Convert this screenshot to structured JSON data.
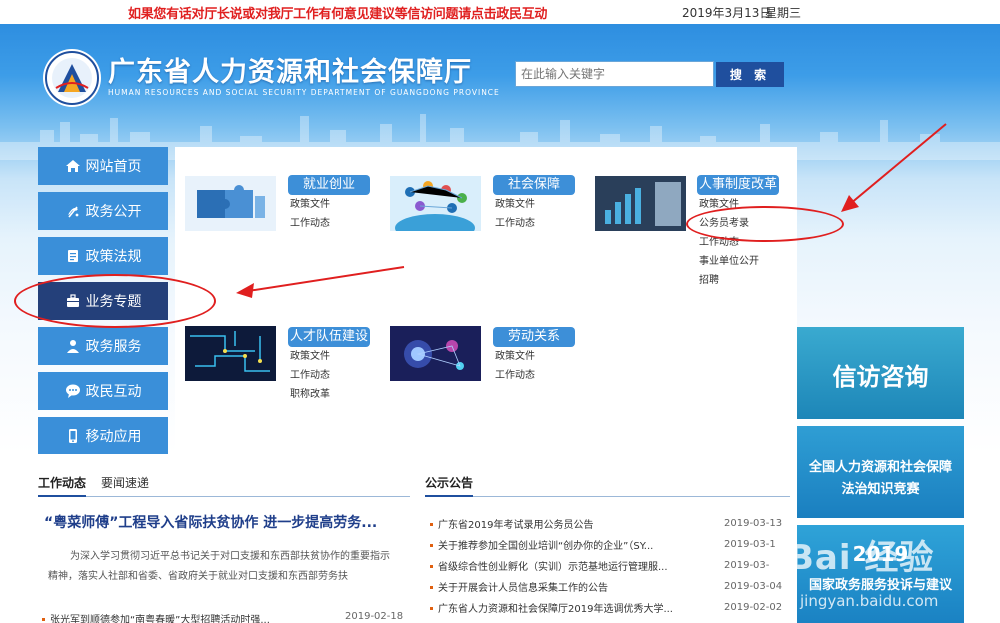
{
  "topbar": {
    "notice": "如果您有话对厅长说或对我厅工作有何意见建议等信访问题请点击政民互动",
    "date": "2019年3月13日",
    "weekday": "星期三"
  },
  "header": {
    "title": "广东省人力资源和社会保障厅",
    "subtitle": "HUMAN RESOURCES AND SOCIAL SECURITY DEPARTMENT OF GUANGDONG PROVINCE"
  },
  "search": {
    "placeholder": "在此输入关键字",
    "button_label": "搜 索"
  },
  "nav": {
    "items": [
      {
        "label": "网站首页",
        "icon": "home-icon"
      },
      {
        "label": "政务公开",
        "icon": "emblem-icon"
      },
      {
        "label": "政策法规",
        "icon": "document-icon"
      },
      {
        "label": "业务专题",
        "icon": "briefcase-icon",
        "active": true
      },
      {
        "label": "政务服务",
        "icon": "user-service-icon"
      },
      {
        "label": "政民互动",
        "icon": "chat-icon"
      },
      {
        "label": "移动应用",
        "icon": "phone-icon"
      }
    ]
  },
  "categories": [
    {
      "title": "就业创业",
      "links": [
        "政策文件",
        "工作动态"
      ]
    },
    {
      "title": "社会保障",
      "links": [
        "政策文件",
        "工作动态"
      ]
    },
    {
      "title": "人事制度改革",
      "links": [
        "政策文件",
        "公务员考录",
        "工作动态",
        "事业单位公开",
        "招聘"
      ]
    },
    {
      "title": "人才队伍建设",
      "links": [
        "政策文件",
        "工作动态",
        "职称改革"
      ]
    },
    {
      "title": "劳动关系",
      "links": [
        "政策文件",
        "工作动态"
      ]
    }
  ],
  "news": {
    "tabs": [
      "工作动态",
      "要闻速递"
    ],
    "headline": "“粤菜师傅”工程导入省际扶贫协作 进一步提高劳务...",
    "summary": "为深入学习贯彻习近平总书记关于对口支援和东西部扶贫协作的重要指示精神，落实人社部和省委、省政府关于就业对口支援和东西部劳务扶",
    "items": [
      {
        "title": "张光军到顺德参加“南粤春暖”大型招聘活动时强...",
        "date": "2019-02-18"
      }
    ]
  },
  "notices": {
    "title": "公示公告",
    "items": [
      {
        "title": "广东省2019年考试录用公务员公告",
        "date": "2019-03-13"
      },
      {
        "title": "关于推荐参加全国创业培训“创办你的企业”（SY...",
        "date": "2019-03-1"
      },
      {
        "title": "省级综合性创业孵化（实训）示范基地运行管理服...",
        "date": "2019-03-"
      },
      {
        "title": "关于开展会计人员信息采集工作的公告",
        "date": "2019-03-04"
      },
      {
        "title": "广东省人力资源和社会保障厅2019年选调优秀大学...",
        "date": "2019-02-02"
      }
    ]
  },
  "side": {
    "box1": "信访咨询",
    "box2_line1": "全国人力资源和社会保障",
    "box2_line2": "法治知识竞赛",
    "box3_year": "2019",
    "box3_line1": "国家政务服务投诉与建议"
  },
  "watermark": {
    "main": "Bai 经验",
    "url": "jingyan.baidu.com"
  },
  "colors": {
    "nav_bg": "#3a8fd9",
    "nav_active": "#24407a",
    "category_label": "#3d8fd8",
    "notice_red": "#e02020",
    "annotation_red": "#e01f1f",
    "headline_blue": "#1f3e8a"
  }
}
